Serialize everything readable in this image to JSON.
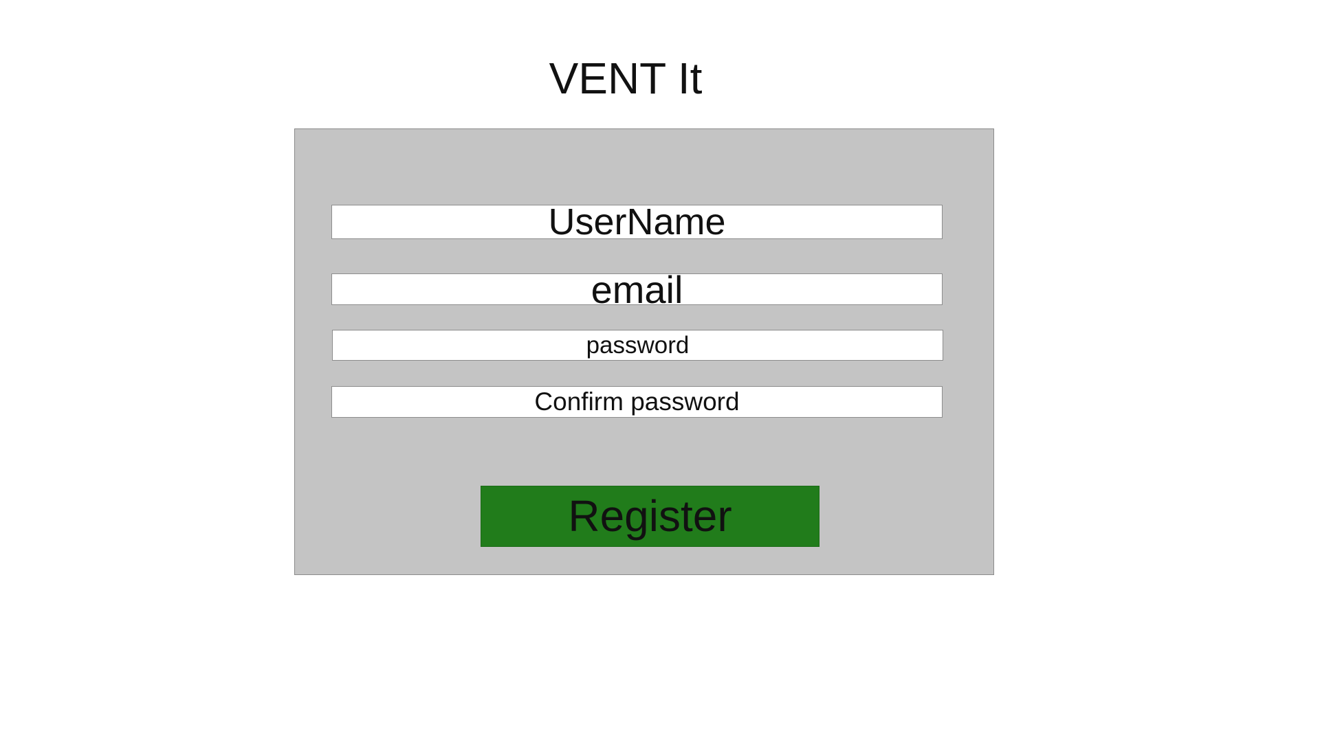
{
  "app": {
    "title": "VENT It"
  },
  "form": {
    "username": {
      "placeholder": "UserName",
      "value": ""
    },
    "email": {
      "placeholder": "email",
      "value": ""
    },
    "password": {
      "placeholder": "password",
      "value": ""
    },
    "confirm_password": {
      "placeholder": "Confirm password",
      "value": ""
    },
    "register_label": "Register"
  },
  "colors": {
    "page_background": "#ffffff",
    "panel_background": "#c4c4c4",
    "field_background": "#ffffff",
    "register_button": "#217c1b",
    "text": "#111111"
  }
}
